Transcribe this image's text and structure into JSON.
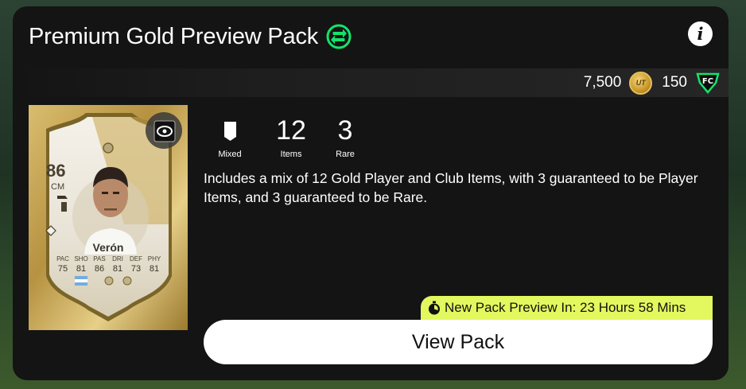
{
  "header": {
    "title": "Premium Gold Preview Pack",
    "tradeable_icon": "swap-arrows-icon",
    "info_label": "i"
  },
  "currency": {
    "coins": "7,500",
    "coin_label": "UT",
    "points": "150",
    "points_label": "FC"
  },
  "card": {
    "rating": "86",
    "position": "CM",
    "name": "Verón",
    "stat_labels": [
      "PAC",
      "SHO",
      "PAS",
      "DRI",
      "DEF",
      "PHY"
    ],
    "stat_values": [
      "75",
      "81",
      "86",
      "81",
      "73",
      "81"
    ],
    "nation": "Argentina",
    "card_color": "#c9a64b"
  },
  "pack_stats": [
    {
      "value": "",
      "icon": "card-icon",
      "label": "Mixed"
    },
    {
      "value": "12",
      "label": "Items"
    },
    {
      "value": "3",
      "label": "Rare"
    }
  ],
  "description": "Includes a mix of 12 Gold Player and Club Items, with 3 guaranteed to be Player Items, and 3 guaranteed to be Rare.",
  "preview": {
    "text": "New Pack Preview In: 23 Hours 58 Mins",
    "color": "#e3f75e"
  },
  "actions": {
    "view_pack_label": "View Pack"
  },
  "colors": {
    "panel": "#141414",
    "accent_green": "#14e36b",
    "button": "#ffffff"
  }
}
